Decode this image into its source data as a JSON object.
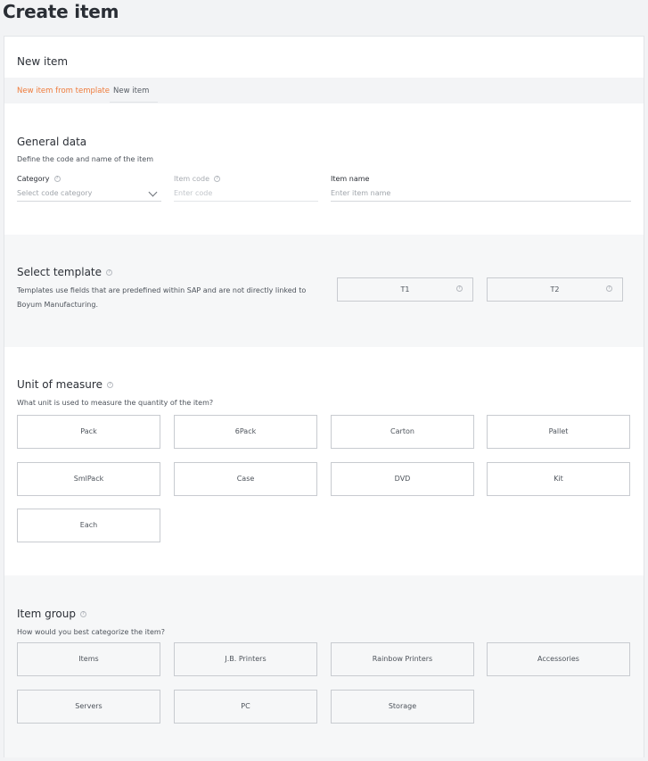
{
  "page": {
    "title": "Create item"
  },
  "card": {
    "title": "New item",
    "tabs": [
      {
        "label": "New item from template",
        "active": true
      },
      {
        "label": "New item",
        "active": false
      }
    ]
  },
  "general": {
    "title": "General data",
    "description": "Define the code and name of the item",
    "category": {
      "label": "Category",
      "placeholder": "Select code category"
    },
    "item_code": {
      "label": "Item code",
      "placeholder": "Enter code"
    },
    "item_name": {
      "label": "Item name",
      "placeholder": "Enter item name"
    }
  },
  "template": {
    "title": "Select template",
    "description_line1": "Templates use fields that are predefined within SAP and are not directly linked to",
    "description_line2": "Boyum Manufacturing.",
    "options": [
      "T1",
      "T2"
    ]
  },
  "uom": {
    "title": "Unit of measure",
    "description": "What unit is used to measure the quantity of the item?",
    "options": [
      "Pack",
      "6Pack",
      "Carton",
      "Pallet",
      "SmlPack",
      "Case",
      "DVD",
      "Kit",
      "Each"
    ]
  },
  "item_group": {
    "title": "Item group",
    "description": "How would you best categorize the item?",
    "options": [
      "Items",
      "J.B. Printers",
      "Rainbow Printers",
      "Accessories",
      "Servers",
      "PC",
      "Storage"
    ]
  },
  "icons": {
    "help": "help-circle-icon",
    "chevron": "chevron-down-icon"
  },
  "colors": {
    "accent": "#ef7b3b",
    "section_alt_bg": "#f6f7f8",
    "page_bg": "#f2f3f5"
  }
}
